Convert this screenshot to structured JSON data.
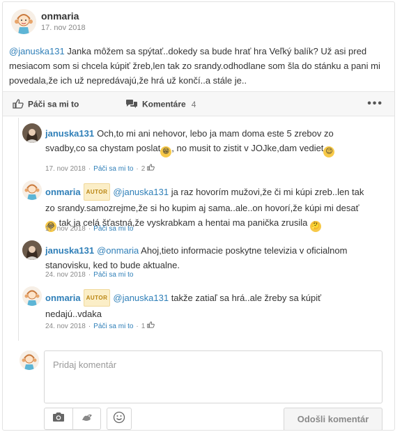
{
  "post": {
    "author": "onmaria",
    "date": "17. nov 2018",
    "mention": "@januska131",
    "body": " Janka môžem sa spýtať..dokedy sa bude hrať hra Veľký balík? Už asi pred mesiacom som si chcela kúpiť žreb,len tak zo srandy.odhodlane som šla do stánku a pani mi povedala,že ich už nepredávajú,že hrá už končí..a stále je.."
  },
  "actions": {
    "like_label": "Páči sa mi to",
    "comments_label": "Komentáre",
    "comments_count": "4",
    "more_label": "•••"
  },
  "comments": [
    {
      "author": "januska131",
      "badge": "",
      "mention": "",
      "text1": "Och,to mi ani nehovor, lebo ja mam doma este 5 zrebov zo svadby,co sa chystam poslat",
      "text2": ", no musit to zistit v JOJke,dam vediet",
      "date": "17. nov 2018",
      "like_label": "Páči sa mi to",
      "likes": "2"
    },
    {
      "author": "onmaria",
      "badge": "AUTOR",
      "mention": "@januska131",
      "text1": " ja raz hovorím mužovi,že či mi kúpi zreb..len tak zo srandy.samozrejme,že si ho kupim aj sama..ale..on hovorí,že kúpi mi desať",
      "text2": " tak ja celá šťastná,že vyskrabkam a hentai ma panička zrusila",
      "date": "17. nov 2018",
      "like_label": "Páči sa mi to",
      "likes": ""
    },
    {
      "author": "januska131",
      "badge": "",
      "mention": "@onmaria",
      "text1": " Ahoj,tieto informacie poskytne televizia v oficialnom stanovisku, ked to bude aktualne.",
      "text2": "",
      "date": "24. nov 2018",
      "like_label": "Páči sa mi to",
      "likes": ""
    },
    {
      "author": "onmaria",
      "badge": "AUTOR",
      "mention": "@januska131",
      "text1": " takže zatiaľ sa hrá..ale žreby sa kúpiť nedajú..vdaka",
      "text2": "",
      "date": "24. nov 2018",
      "like_label": "Páči sa mi to",
      "likes": "1"
    }
  ],
  "composer": {
    "placeholder": "Pridaj komentár",
    "send_label": "Odošli komentár"
  },
  "icons": {
    "like": "thumbs-up-icon",
    "comments": "speech-bubbles-icon",
    "camera": "camera-icon",
    "gif": "sticker-icon",
    "emoji": "smiley-icon"
  },
  "colors": {
    "link": "#2f7fb8",
    "badge_bg": "#fbeec7",
    "badge_text": "#b98410"
  }
}
